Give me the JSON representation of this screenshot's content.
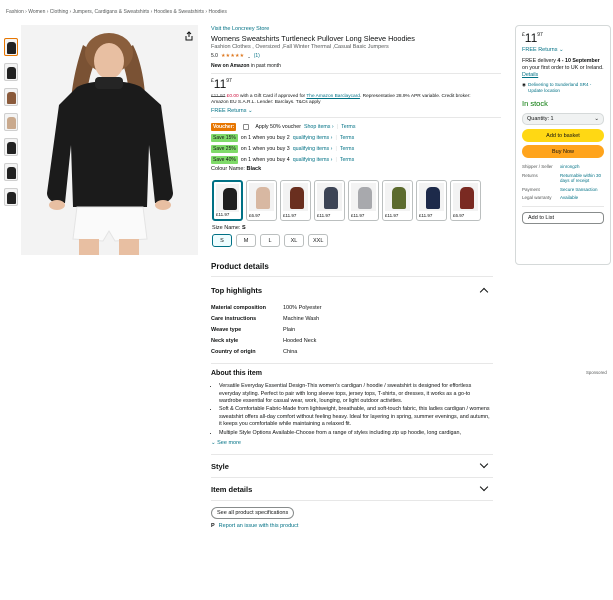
{
  "breadcrumb": "Fashion › Women › Clothing › Jumpers, Cardigans & Sweatshirts › Hoodies & Sweatshirts › Hoodies",
  "product": {
    "store_link": "Visit the Loncreey Store",
    "title": "Womens Sweatshirts Turtleneck Pullover Long Sleeve Hoodies",
    "subtitle": "Fashion Clothes , Oversized ,Fall Winter Thermal ,Casual Basic Jumpers",
    "rating_value": "5.0",
    "rating_stars": "★★★★★",
    "rating_count": "(1)",
    "new_on_amazon": "New on Amazon",
    "new_on_amazon_suffix": "in past month",
    "price_currency": "£",
    "price_whole": "11",
    "price_fraction": "97",
    "gift_card_old": "£11.97",
    "gift_card_new": "£0.00",
    "gift_card_text": "with a Gift Card if approved for",
    "gift_card_link": "The Amazon Barclaycard",
    "gift_card_rest": ". Representative 28.9% APR variable. Credit broker:",
    "gift_card_line2": "Amazon EU S.A.R.L. Lender: Barclays. T&Cs apply",
    "free_returns": "FREE Returns",
    "voucher_badge": "Voucher:",
    "voucher_text": "Apply 50% voucher",
    "shop_items": "Shop items ›",
    "terms": "Terms",
    "discounts": [
      {
        "badge": "Save 15%",
        "text": "on 1 when you buy 2",
        "link": "qualifying items ›",
        "terms": "Terms"
      },
      {
        "badge": "Save 25%",
        "text": "on 1 when you buy 3",
        "link": "qualifying items ›",
        "terms": "Terms"
      },
      {
        "badge": "Save 40%",
        "text": "on 1 when you buy 4",
        "link": "qualifying items ›",
        "terms": "Terms"
      }
    ],
    "colour_label": "Colour Name:",
    "colour_value": "Black",
    "swatches": [
      {
        "price": "£11.97",
        "color": "#1e1e1e"
      },
      {
        "price": "£6.97",
        "color": "#d8b8a2"
      },
      {
        "price": "£11.97",
        "color": "#6a2f1f"
      },
      {
        "price": "£11.97",
        "color": "#3d4556"
      },
      {
        "price": "£11.97",
        "color": "#a8a9ad"
      },
      {
        "price": "£11.97",
        "color": "#5c6b2e"
      },
      {
        "price": "£11.97",
        "color": "#1d2a4a"
      },
      {
        "price": "£6.97",
        "color": "#7a2a22"
      }
    ],
    "size_label": "Size Name:",
    "size_value": "S",
    "sizes": [
      "S",
      "M",
      "L",
      "XL",
      "XXL"
    ]
  },
  "details": {
    "heading": "Product details",
    "highlights_heading": "Top highlights",
    "specs": [
      {
        "key": "Material composition",
        "value": "100% Polyester"
      },
      {
        "key": "Care instructions",
        "value": "Machine Wash"
      },
      {
        "key": "Weave type",
        "value": "Plain"
      },
      {
        "key": "Neck style",
        "value": "Hooded Neck"
      },
      {
        "key": "Country of origin",
        "value": "China"
      }
    ],
    "about_heading": "About this item",
    "about_bullets": [
      "Versatile Everyday Essential Design-This women's cardigan / hoodie / sweatshirt is designed for effortless everyday styling. Perfect to pair with long sleeve tops, jersey tops, T-shirts, or dresses, it works as a go-to wardrobe essential for casual wear, work, lounging, or light outdoor activities.",
      "Soft & Comfortable Fabric-Made from lightweight, breathable, and soft-touch fabric, this ladies cardigan / womens sweatshirt offers all-day comfort without feeling heavy. Ideal for layering in spring, summer evenings, and autumn, it keeps you comfortable while maintaining a relaxed fit.",
      "Multiple Style Options Available-Choose from a range of styles including zip up hoodie, long cardigan,"
    ],
    "see_more": "See more",
    "style_heading": "Style",
    "item_details_heading": "Item details",
    "see_all_specs": "See all product specifications",
    "report_issue": "Report an issue with this product",
    "sponsored": "Sponsored"
  },
  "buybox": {
    "price_currency": "£",
    "price_whole": "11",
    "price_fraction": "97",
    "free_returns": "FREE Returns",
    "delivery_prefix": "FREE delivery",
    "delivery_date": "4 - 10 September",
    "delivery_suffix": "on your first order to UK or Ireland.",
    "details_link": "Details",
    "deliver_to": "Delivering to Sunderland SR4 - Update location",
    "stock": "In stock",
    "quantity": "Quantity: 1",
    "add_basket": "Add to basket",
    "buy_now": "Buy Now",
    "seller_rows": [
      {
        "key": "Shipper / Seller",
        "value": "xinrongzh"
      },
      {
        "key": "Returns",
        "value": "Returnable within 30 days of receipt"
      },
      {
        "key": "Payment",
        "value": "Secure transaction"
      },
      {
        "key": "Legal warranty",
        "value": "Available"
      }
    ],
    "add_to_list": "Add to List"
  },
  "colors": {
    "link": "#007185",
    "price_red": "#cc0c39",
    "stock_green": "#007600",
    "button_yellow": "#ffd814",
    "button_orange": "#ffa41c",
    "voucher_orange": "#e77600",
    "save_green": "#7fda69"
  }
}
